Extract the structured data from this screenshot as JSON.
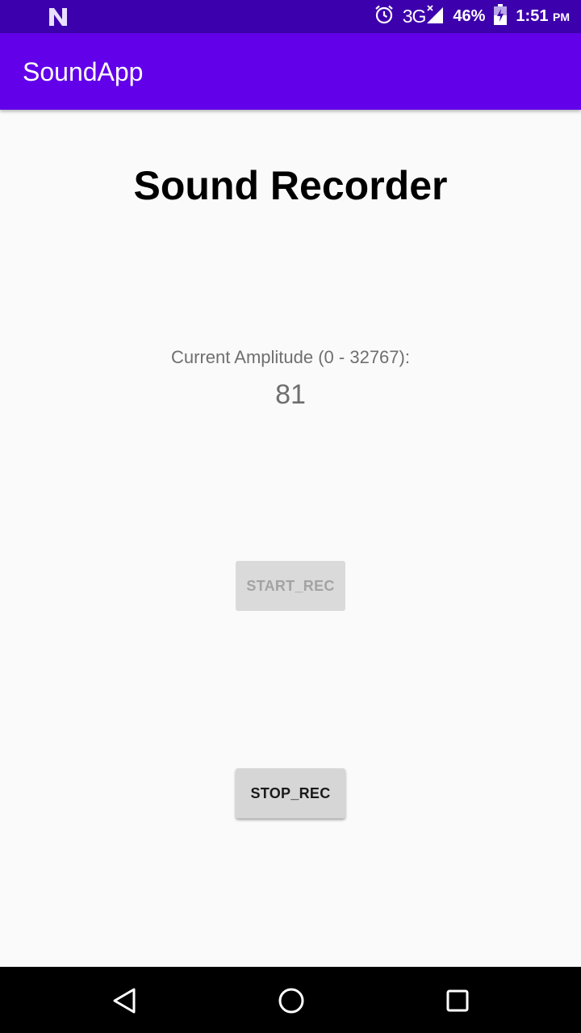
{
  "status_bar": {
    "network": "3G",
    "battery_percent": "46%",
    "time": "1:51",
    "ampm": "PM",
    "icons": [
      "n-notification-icon",
      "alarm-icon",
      "signal-icon",
      "battery-charging-icon"
    ]
  },
  "app_bar": {
    "title": "SoundApp",
    "color": "#6200ea"
  },
  "main": {
    "heading": "Sound Recorder",
    "amplitude_label": "Current Amplitude (0 - 32767):",
    "amplitude_value": "81",
    "start_button": "START_REC",
    "stop_button": "STOP_REC"
  },
  "nav_bar": {
    "icons": [
      "back-icon",
      "home-icon",
      "recents-icon"
    ]
  }
}
